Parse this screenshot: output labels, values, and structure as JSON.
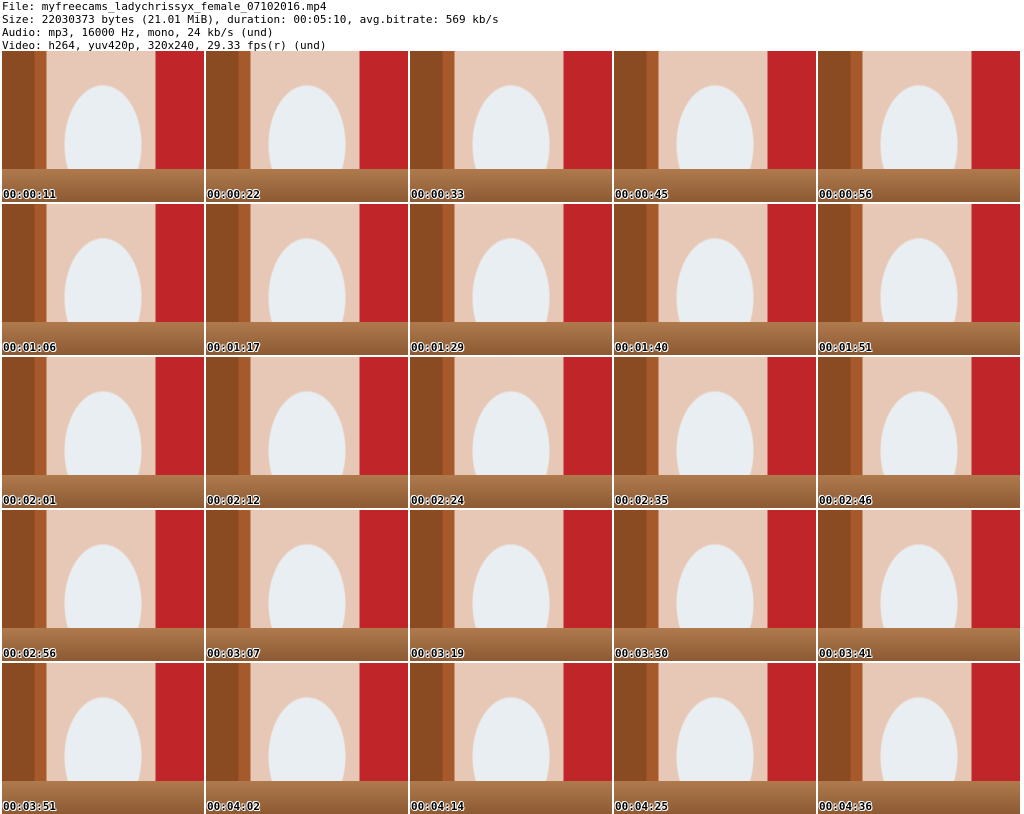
{
  "header": {
    "file": "File: myfreecams_ladychrissyx_female_07102016.mp4",
    "size": "Size: 22030373 bytes (21.01 MiB), duration: 00:05:10, avg.bitrate: 569 kb/s",
    "audio": "Audio: mp3, 16000 Hz, mono, 24 kb/s (und)",
    "video": "Video: h264, yuv420p, 320x240, 29.33 fps(r) (und)"
  },
  "thumbnails": [
    "00:00:11",
    "00:00:22",
    "00:00:33",
    "00:00:45",
    "00:00:56",
    "00:01:06",
    "00:01:17",
    "00:01:29",
    "00:01:40",
    "00:01:51",
    "00:02:01",
    "00:02:12",
    "00:02:24",
    "00:02:35",
    "00:02:46",
    "00:02:56",
    "00:03:07",
    "00:03:19",
    "00:03:30",
    "00:03:41",
    "00:03:51",
    "00:04:02",
    "00:04:14",
    "00:04:25",
    "00:04:36"
  ]
}
